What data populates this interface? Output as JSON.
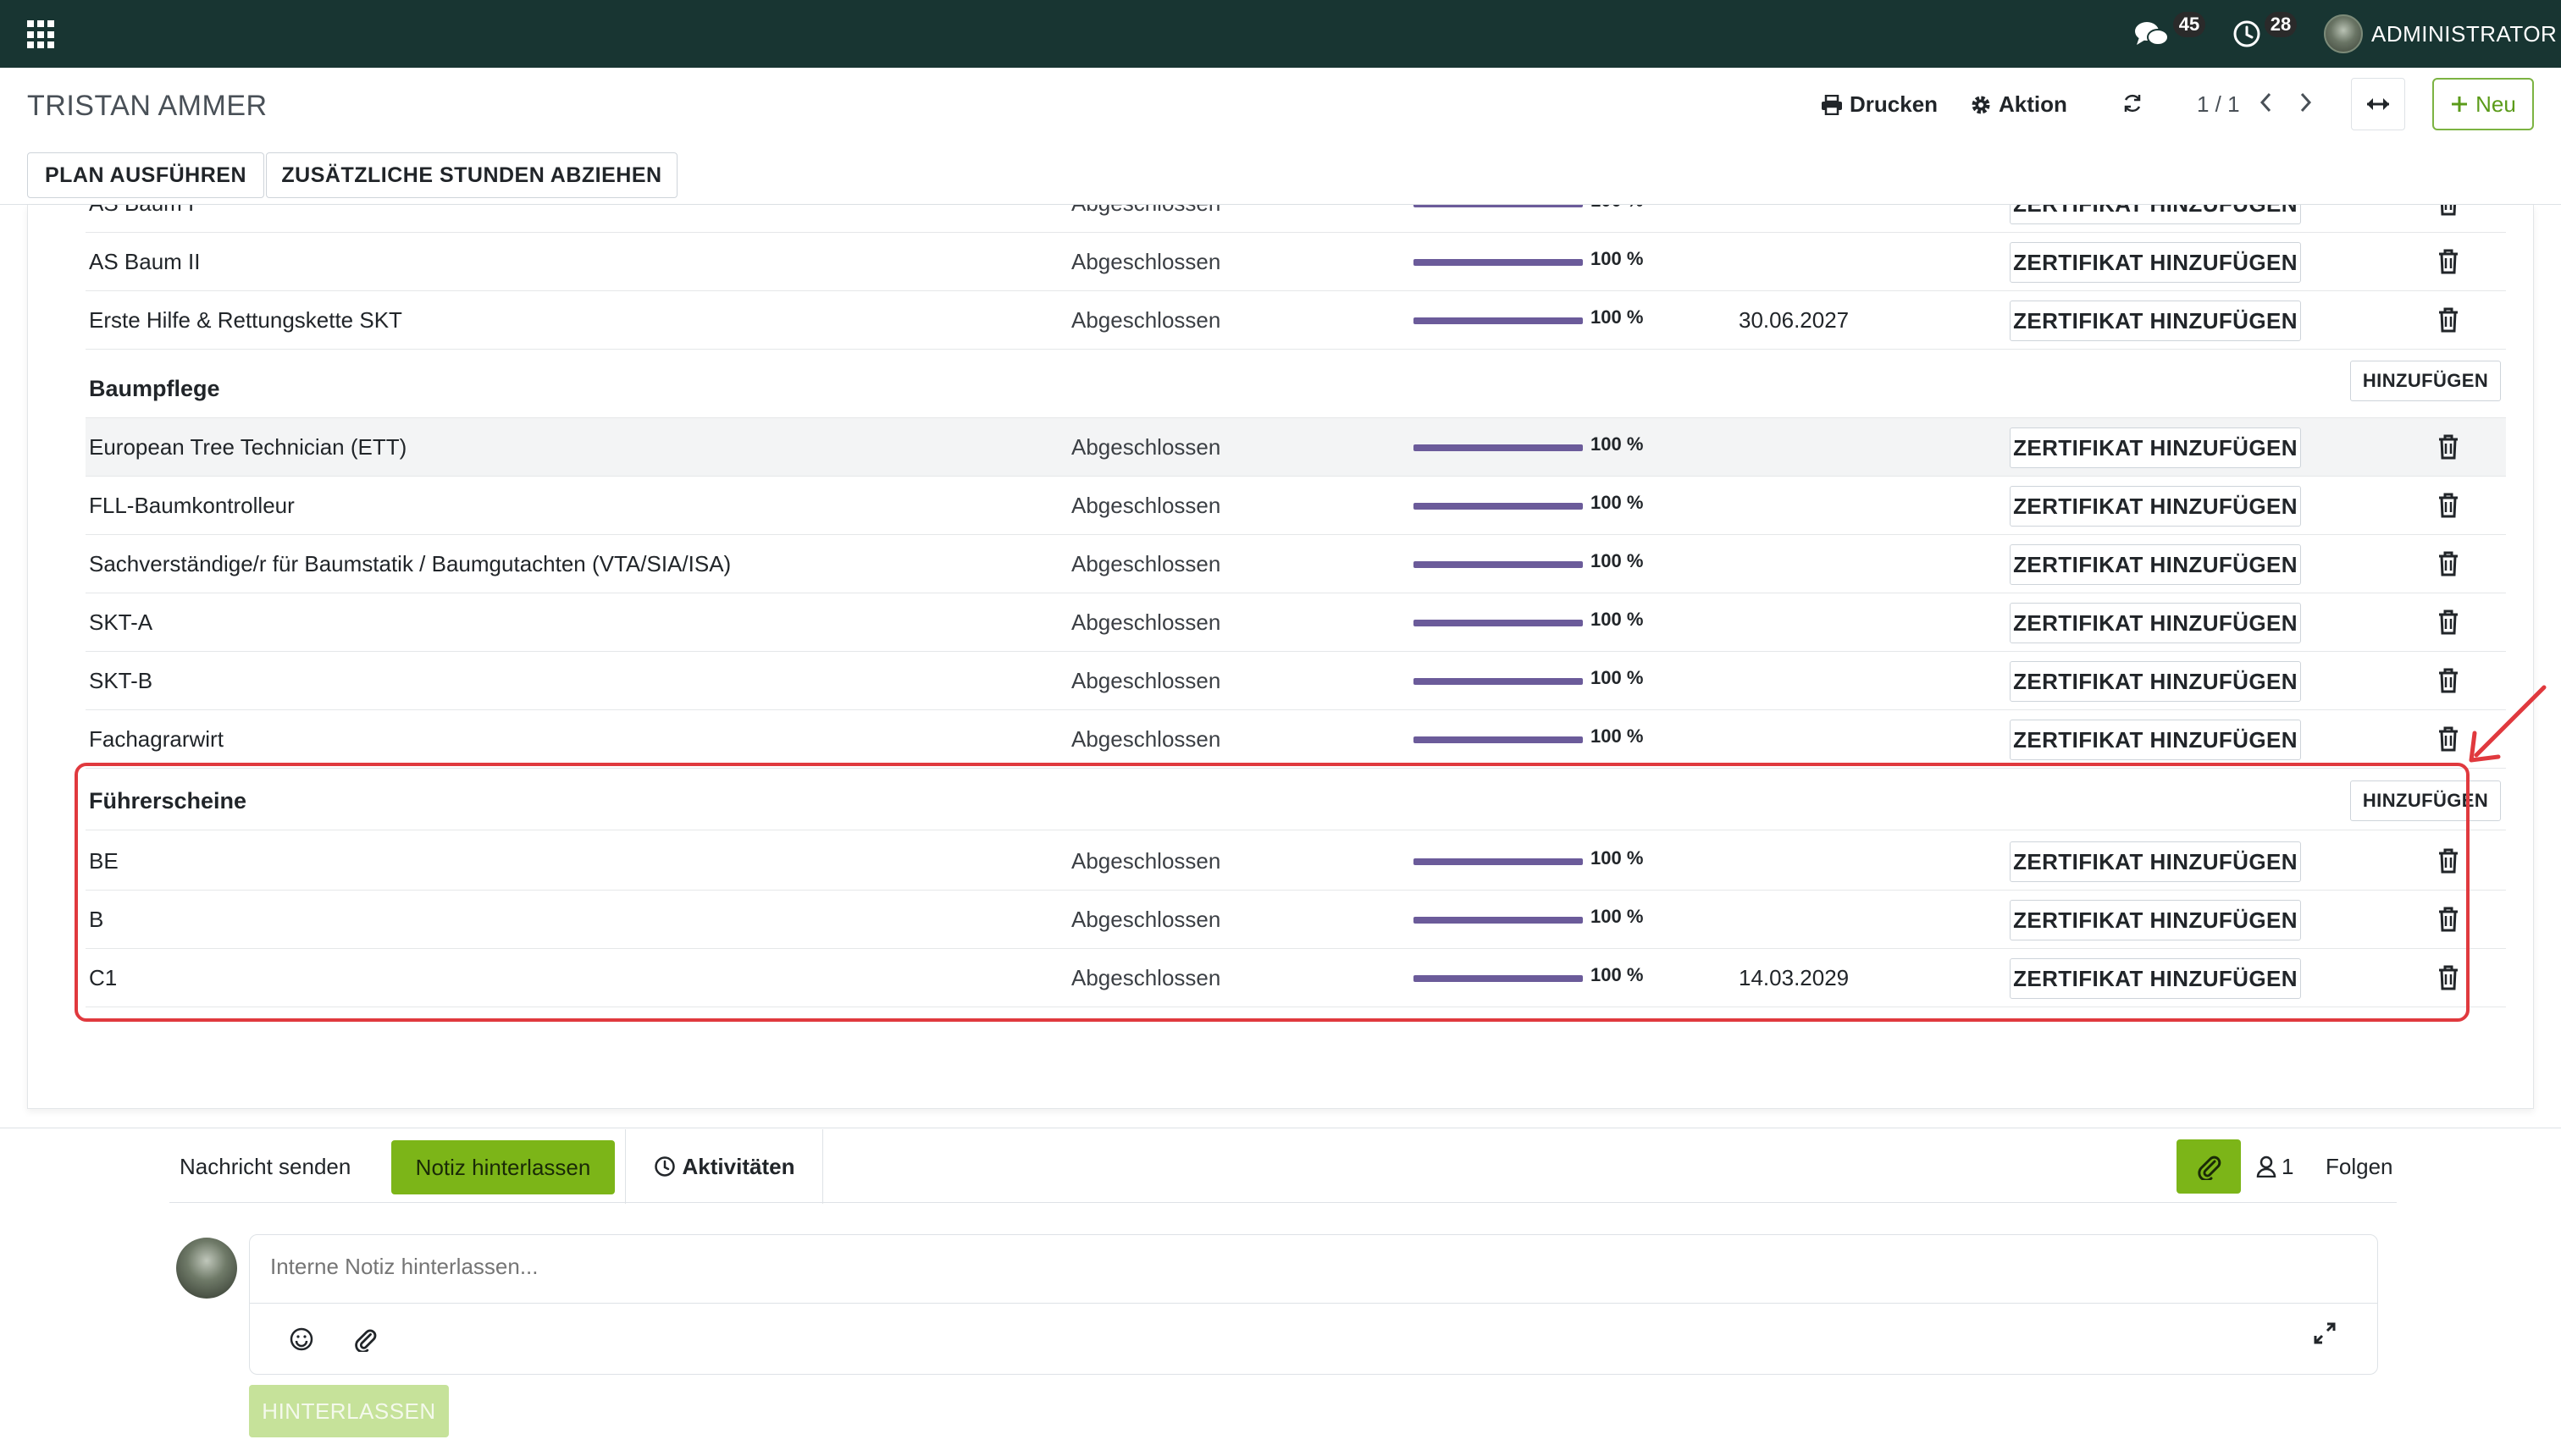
{
  "topnav": {
    "apps_icon": "apps-grid-icon",
    "messages_count": "45",
    "activities_count": "28",
    "user_name": "ADMINISTRATOR",
    "bg_color": "#183532"
  },
  "control_panel": {
    "title": "TRISTAN AMMER",
    "print_label": "Drucken",
    "action_label": "Aktion",
    "pager": "1 / 1",
    "new_label": "Neu",
    "header_buttons": {
      "run_plan": "PLAN AUSFÜHREN",
      "deduct_hours": "ZUSÄTZLICHE STUNDEN ABZIEHEN"
    }
  },
  "common": {
    "status": "Abgeschlossen",
    "progress_text": "100 %",
    "progress_value": 100,
    "cert_button": "ZERTIFIKAT HINZUFÜGEN",
    "add_button": "HINZUFÜGEN",
    "bar_color": "#6b5b9a"
  },
  "rows_top": [
    {
      "name": "AS Baum I",
      "date": ""
    },
    {
      "name": "AS Baum II",
      "date": ""
    },
    {
      "name": "Erste Hilfe & Rettungskette SKT",
      "date": "30.06.2027"
    }
  ],
  "section_baumpflege": {
    "title": "Baumpflege",
    "rows": [
      {
        "name": "European Tree Technician (ETT)",
        "date": ""
      },
      {
        "name": "FLL-Baumkontrolleur",
        "date": ""
      },
      {
        "name": "Sachverständige/r für Baumstatik / Baumgutachten (VTA/SIA/ISA)",
        "date": ""
      },
      {
        "name": "SKT-A",
        "date": ""
      },
      {
        "name": "SKT-B",
        "date": ""
      },
      {
        "name": "Fachagrarwirt",
        "date": ""
      }
    ]
  },
  "section_fuehrerscheine": {
    "title": "Führerscheine",
    "rows": [
      {
        "name": "BE",
        "date": ""
      },
      {
        "name": "B",
        "date": ""
      },
      {
        "name": "C1",
        "date": "14.03.2029"
      }
    ]
  },
  "annotation": {
    "highlight_color": "#e0393e"
  },
  "chatter": {
    "send_message": "Nachricht senden",
    "log_note": "Notiz hinterlassen",
    "activities": "Aktivitäten",
    "followers_count": "1",
    "follow": "Folgen",
    "composer_placeholder": "Interne Notiz hinterlassen...",
    "submit": "HINTERLASSEN",
    "accent_color": "#7cb518"
  }
}
